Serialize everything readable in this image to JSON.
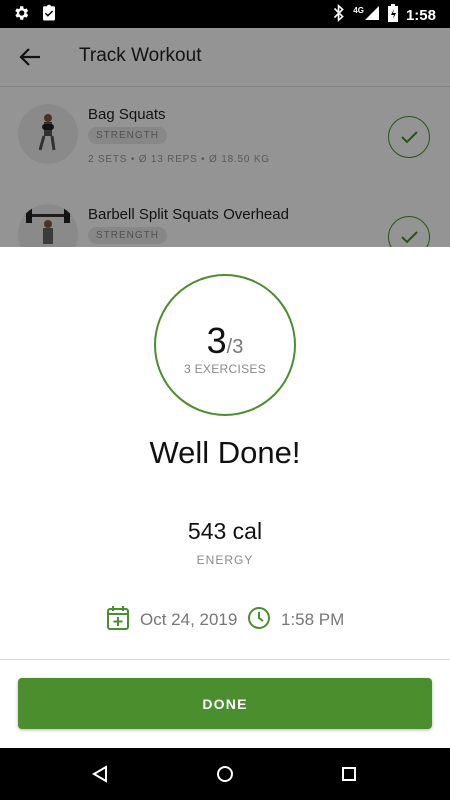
{
  "status_bar": {
    "time": "1:58",
    "network": "4G"
  },
  "app_bar": {
    "title": "Track Workout"
  },
  "exercises": [
    {
      "name": "Bag Squats",
      "category": "STRENGTH",
      "stats": "2 SETS • Ø 13 REPS  • Ø 18.50 KG"
    },
    {
      "name": "Barbell Split Squats Overhead",
      "category": "STRENGTH",
      "stats": ""
    }
  ],
  "summary": {
    "completed": "3",
    "total": "/3",
    "exercises_label": "3 EXERCISES",
    "headline": "Well Done!",
    "energy_value": "543 cal",
    "energy_label": "ENERGY",
    "date": "Oct 24, 2019",
    "time": "1:58 PM"
  },
  "actions": {
    "done_label": "DONE"
  },
  "colors": {
    "accent": "#4a8e2d",
    "scrim": "rgba(0,0,0,0.42)"
  },
  "icons": [
    "settings-icon",
    "task-icon",
    "bluetooth-icon",
    "signal-icon",
    "battery-icon",
    "back-arrow-icon",
    "check-icon",
    "calendar-add-icon",
    "clock-icon",
    "nav-back-icon",
    "nav-home-icon",
    "nav-recents-icon"
  ]
}
